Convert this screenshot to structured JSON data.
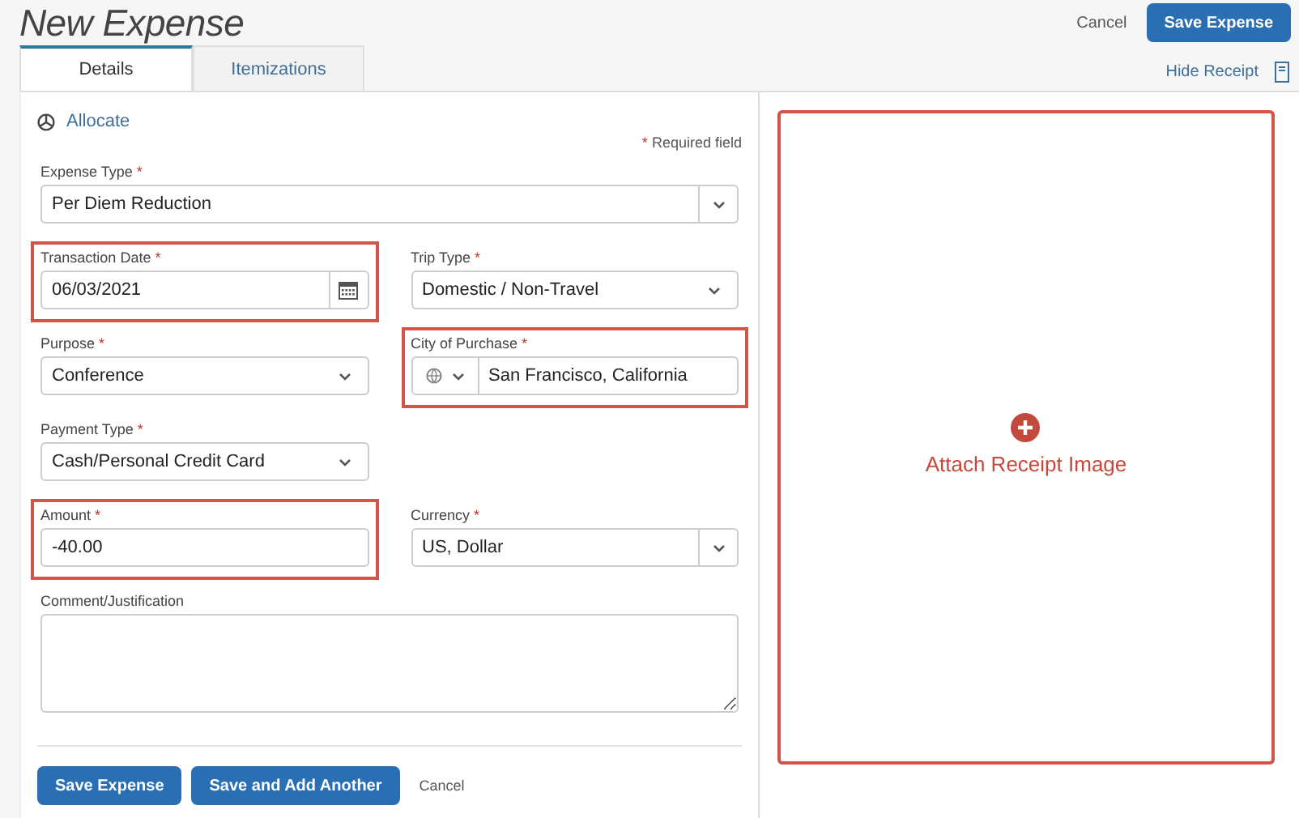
{
  "title": "New Expense",
  "header_actions": {
    "cancel": "Cancel",
    "save": "Save Expense"
  },
  "tabs": [
    {
      "label": "Details",
      "selected": true
    },
    {
      "label": "Itemizations",
      "selected": false
    }
  ],
  "hide_receipt": "Hide Receipt",
  "allocate": "Allocate",
  "required_note": {
    "mark": "*",
    "text": "Required field"
  },
  "rows": [
    {
      "kind": "full",
      "fields": [
        {
          "kind": "combo",
          "label": "Expense Type",
          "required": true,
          "highlighted": false,
          "value": "Per Diem Reduction"
        }
      ]
    },
    {
      "kind": "pair",
      "fields": [
        {
          "kind": "date",
          "label": "Transaction Date",
          "required": true,
          "highlighted": true,
          "value": "06/03/2021"
        },
        {
          "kind": "select",
          "label": "Trip Type",
          "required": true,
          "highlighted": false,
          "value": "Domestic / Non-Travel"
        }
      ]
    },
    {
      "kind": "pair",
      "fields": [
        {
          "kind": "select",
          "label": "Purpose",
          "required": true,
          "highlighted": false,
          "value": "Conference"
        },
        {
          "kind": "location",
          "label": "City of Purchase",
          "required": true,
          "highlighted": true,
          "value": "San Francisco, California"
        }
      ]
    },
    {
      "kind": "pair",
      "fields": [
        {
          "kind": "select",
          "label": "Payment Type",
          "required": true,
          "highlighted": false,
          "value": "Cash/Personal Credit Card"
        }
      ]
    },
    {
      "kind": "pair",
      "fields": [
        {
          "kind": "text",
          "label": "Amount",
          "required": true,
          "highlighted": true,
          "value": "-40.00"
        },
        {
          "kind": "combo",
          "label": "Currency",
          "required": true,
          "highlighted": false,
          "value": "US, Dollar"
        }
      ]
    },
    {
      "kind": "full",
      "fields": [
        {
          "kind": "textarea",
          "label": "Comment/Justification",
          "required": false,
          "highlighted": false
        }
      ]
    }
  ],
  "footer_buttons": [
    {
      "kind": "primary",
      "label": "Save Expense"
    },
    {
      "kind": "primary",
      "label": "Save and Add Another"
    },
    {
      "kind": "link",
      "label": "Cancel"
    }
  ],
  "receipt": {
    "label": "Attach Receipt Image",
    "highlighted": true
  }
}
